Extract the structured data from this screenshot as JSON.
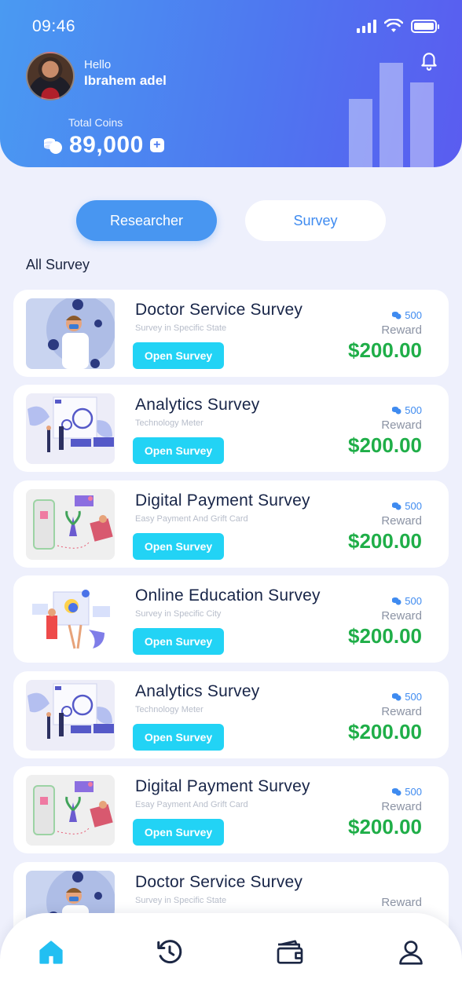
{
  "status": {
    "time": "09:46"
  },
  "header": {
    "greeting": "Hello",
    "username": "Ibrahem adel",
    "coins_label": "Total Coins",
    "coins_value": "89,000",
    "plus": "+"
  },
  "tabs": [
    {
      "label": "Researcher",
      "active": true
    },
    {
      "label": "Survey",
      "active": false
    }
  ],
  "section_title": "All Survey",
  "surveys": [
    {
      "title": "Doctor Service Survey",
      "subtitle": "Survey in Specific State",
      "button": "Open Survey",
      "coins": "500",
      "reward_label": "Reward",
      "price": "$200.00",
      "thumb": "doctor"
    },
    {
      "title": "Analytics Survey",
      "subtitle": "Technology Meter",
      "button": "Open Survey",
      "coins": "500",
      "reward_label": "Reward",
      "price": "$200.00",
      "thumb": "analytics"
    },
    {
      "title": "Digital Payment Survey",
      "subtitle": "Easy Payment And Grift Card",
      "button": "Open Survey",
      "coins": "500",
      "reward_label": "Reward",
      "price": "$200.00",
      "thumb": "payment"
    },
    {
      "title": "Online Education Survey",
      "subtitle": "Survey in Specific City",
      "button": "Open Survey",
      "coins": "500",
      "reward_label": "Reward",
      "price": "$200.00",
      "thumb": "education"
    },
    {
      "title": "Analytics Survey",
      "subtitle": "Technology Meter",
      "button": "Open Survey",
      "coins": "500",
      "reward_label": "Reward",
      "price": "$200.00",
      "thumb": "analytics"
    },
    {
      "title": "Digital Payment Survey",
      "subtitle": "Esay Payment And Grift Card",
      "button": "Open Survey",
      "coins": "500",
      "reward_label": "Reward",
      "price": "$200.00",
      "thumb": "payment"
    },
    {
      "title": "Doctor Service Survey",
      "subtitle": "Survey in Specific State",
      "button": "",
      "coins": "",
      "reward_label": "Reward",
      "price": "",
      "thumb": "doctor"
    }
  ],
  "nav": [
    {
      "icon": "home-icon",
      "active": true
    },
    {
      "icon": "history-icon",
      "active": false
    },
    {
      "icon": "wallet-icon",
      "active": false
    },
    {
      "icon": "profile-icon",
      "active": false
    }
  ],
  "colors": {
    "header_gradient_start": "#4a9af2",
    "header_gradient_end": "#5a5cf0",
    "accent_button": "#22d3f5",
    "price_green": "#1fae48",
    "tab_active": "#4896f1"
  }
}
